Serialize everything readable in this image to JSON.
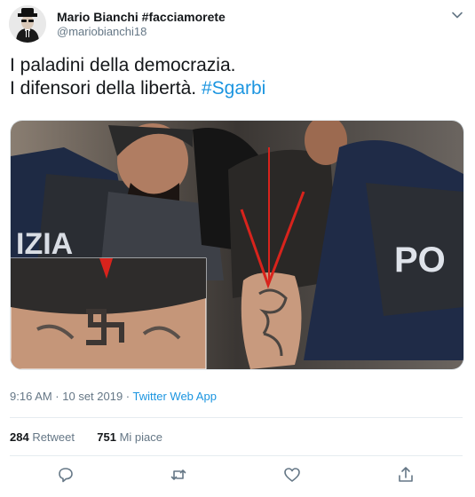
{
  "author": {
    "display_name": "Mario Bianchi #facciamorete",
    "handle": "@mariobianchi18",
    "avatar_icon": "blues-brothers-avatar"
  },
  "tweet": {
    "line1": "I paladini della democrazia.",
    "line2_text": "I difensori della libertà. ",
    "hashtag": "#Sgarbi"
  },
  "media": {
    "description_icon": "photo-police-officers-tattoo",
    "vest_text_left": "IZIA",
    "vest_text_right": "PO"
  },
  "meta": {
    "time": "9:16 AM · 10 set 2019 · ",
    "source": "Twitter Web App"
  },
  "stats": {
    "retweets_count": "284",
    "retweets_label": " Retweet",
    "likes_count": "751",
    "likes_label": " Mi piace"
  },
  "colors": {
    "accent": "#1b95e0",
    "secondary_text": "#657786",
    "primary_text": "#14171a"
  }
}
